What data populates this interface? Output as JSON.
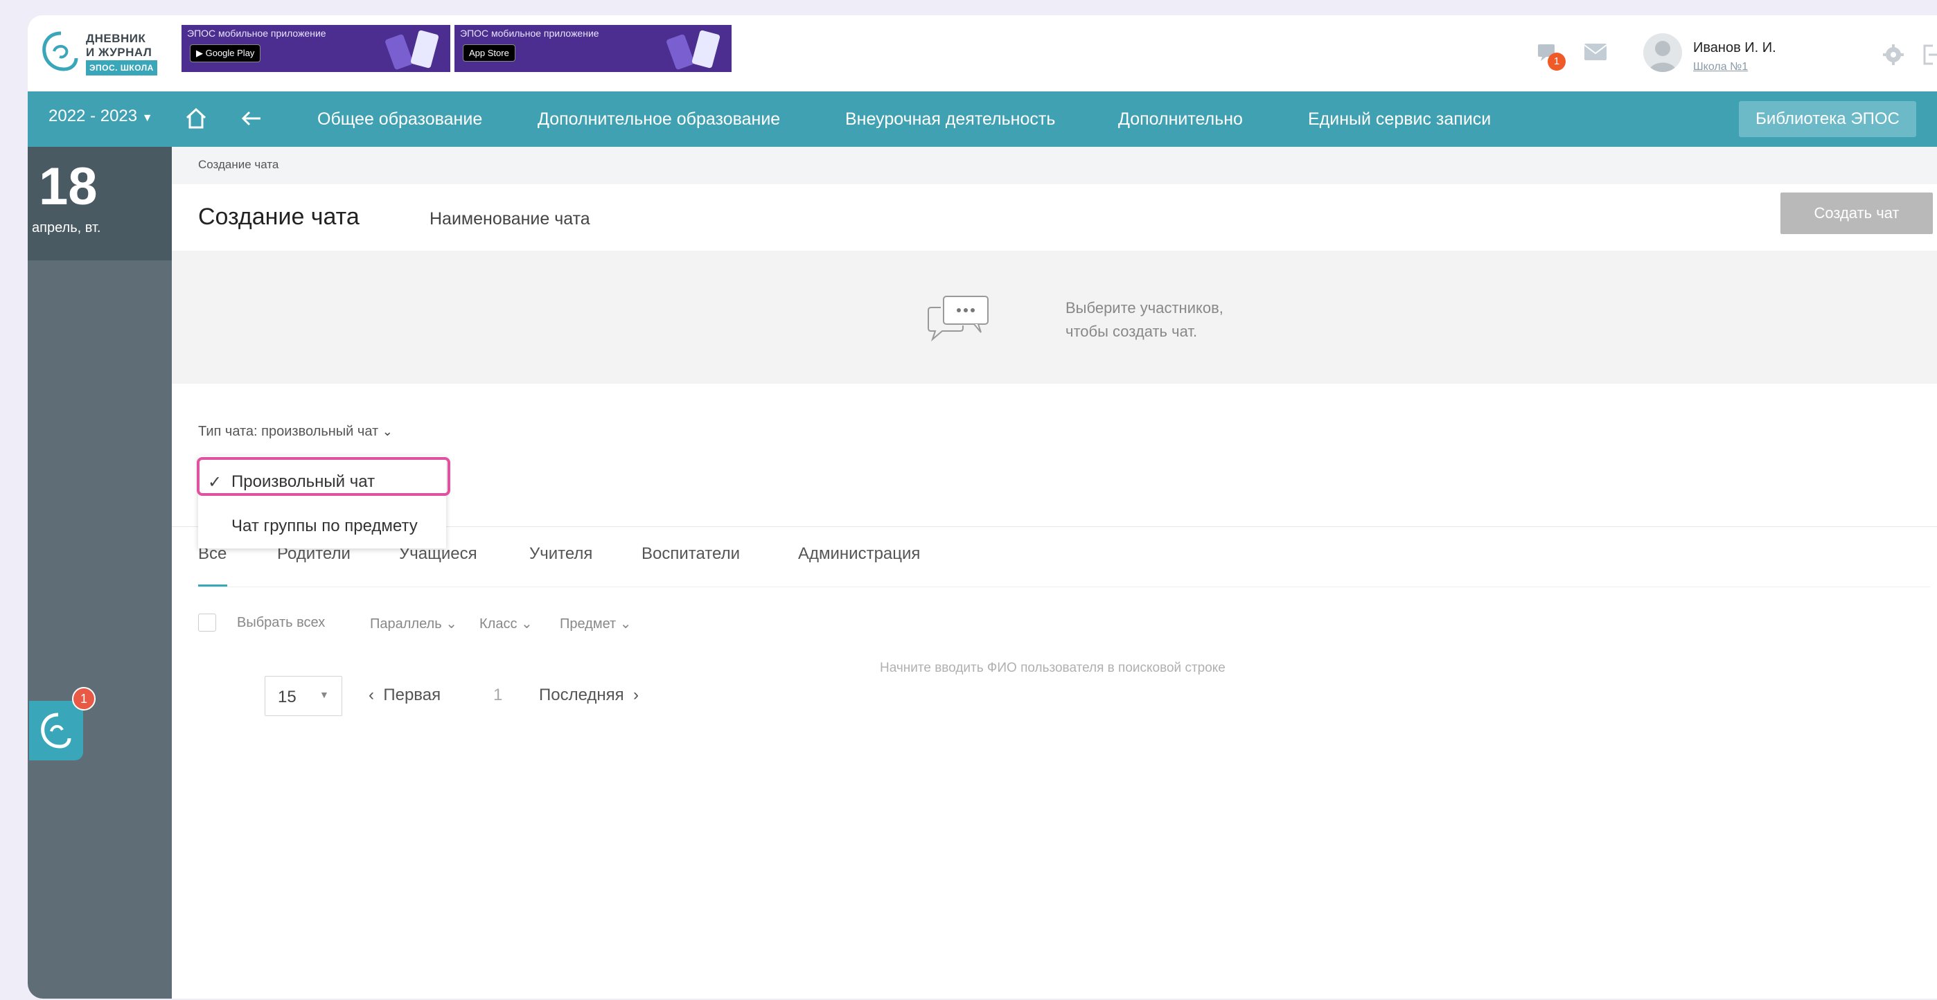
{
  "header": {
    "logo": {
      "line1": "ДНЕВНИК",
      "line2": "И ЖУРНАЛ",
      "badge": "ЭПОС. ШКОЛА"
    },
    "promos": [
      {
        "title": "ЭПОС мобильное приложение",
        "store": "Google Play"
      },
      {
        "title": "ЭПОС мобильное приложение",
        "store": "App Store"
      }
    ],
    "notifications_count": "1",
    "user": {
      "name": "Иванов И. И.",
      "school": "Школа №1"
    }
  },
  "nav": {
    "year": "2022 - 2023",
    "items": [
      "Общее образование",
      "Дополнительное образование",
      "Внеурочная деятельность",
      "Дополнительно",
      "Единый сервис записи"
    ],
    "library": "Библиотека ЭПОС"
  },
  "sidebar": {
    "day": "18",
    "date_label": "апрель, вт.",
    "chat_badge": "1"
  },
  "page": {
    "breadcrumb": "Создание чата",
    "title": "Создание чата",
    "chat_name_placeholder": "Наименование чата",
    "create_button": "Создать чат",
    "empty_text_line1": "Выберите участников,",
    "empty_text_line2": "чтобы создать чат.",
    "chat_type_label": "Тип чата: произвольный чат",
    "dropdown_options": [
      "Произвольный чат",
      "Чат группы по предмету"
    ],
    "tabs": [
      "Все",
      "Родители",
      "Учащиеся",
      "Учителя",
      "Воспитатели",
      "Администрация"
    ],
    "filters": {
      "select_all": "Выбрать всех",
      "parallel": "Параллель",
      "class": "Класс",
      "subject": "Предмет"
    },
    "hint": "Начните вводить ФИО пользователя в поисковой строке",
    "pager": {
      "page_size": "15",
      "first": "Первая",
      "current": "1",
      "last": "Последняя"
    }
  },
  "colors": {
    "nav": "#40a1b3",
    "sidebar": "#5e6d76",
    "accent": "#3aa6b9",
    "highlight": "#e052a0"
  }
}
